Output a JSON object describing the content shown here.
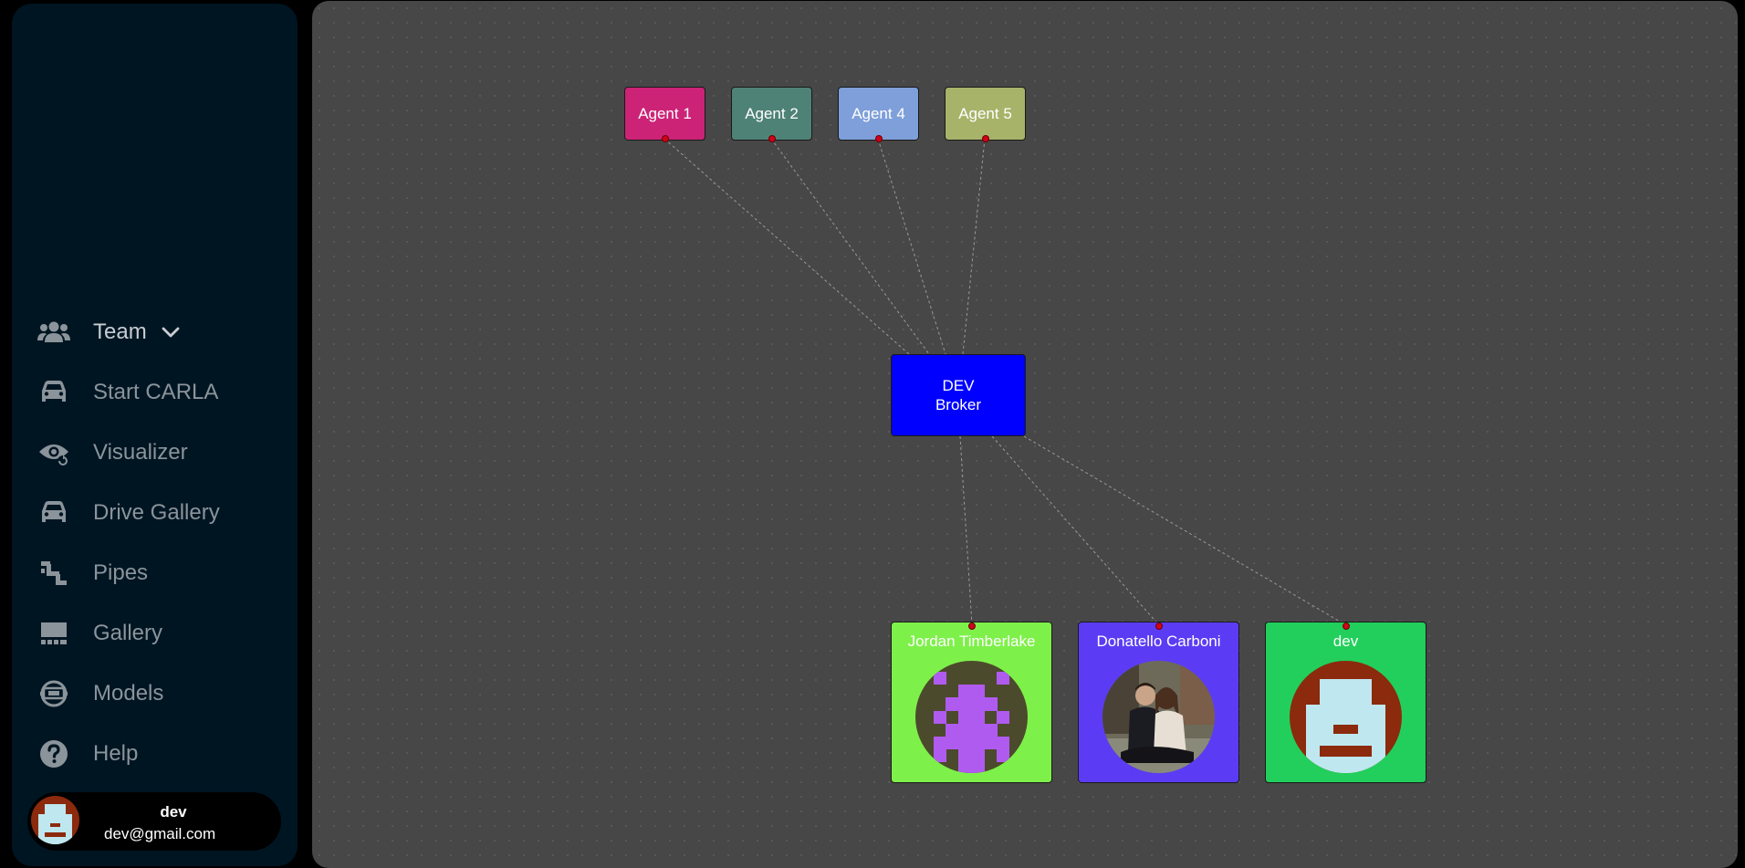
{
  "sidebar": {
    "items": [
      {
        "label": "Team",
        "icon": "team-icon",
        "name": "sidebar-item-team"
      },
      {
        "label": "Start CARLA",
        "icon": "car-icon",
        "name": "sidebar-item-start-carla"
      },
      {
        "label": "Visualizer",
        "icon": "eye-icon",
        "name": "sidebar-item-visualizer"
      },
      {
        "label": "Drive Gallery",
        "icon": "car-icon",
        "name": "sidebar-item-drive-gallery"
      },
      {
        "label": "Pipes",
        "icon": "pipes-icon",
        "name": "sidebar-item-pipes"
      },
      {
        "label": "Gallery",
        "icon": "gallery-icon",
        "name": "sidebar-item-gallery"
      },
      {
        "label": "Models",
        "icon": "models-icon",
        "name": "sidebar-item-models"
      },
      {
        "label": "Help",
        "icon": "help-icon",
        "name": "sidebar-item-help"
      }
    ],
    "user": {
      "name": "dev",
      "email": "dev@gmail.com"
    }
  },
  "graph": {
    "agents": [
      {
        "label": "Agent 1",
        "color": "#cc2377"
      },
      {
        "label": "Agent 2",
        "color": "#4f8277"
      },
      {
        "label": "Agent 4",
        "color": "#7e9fd9"
      },
      {
        "label": "Agent 5",
        "color": "#a8b36a"
      }
    ],
    "broker": {
      "line1": "DEV",
      "line2": "Broker",
      "color": "#0000fe"
    },
    "members": [
      {
        "name": "Jordan Timberlake",
        "color": "#7ef04a",
        "avatar": "purple-pixel-avatar"
      },
      {
        "name": "Donatello Carboni",
        "color": "#5b3cf4",
        "avatar": "couple-photo-avatar"
      },
      {
        "name": "dev",
        "color": "#22cf5c",
        "avatar": "red-pixel-avatar"
      }
    ],
    "handle_color": "#d0021b",
    "edge_color": "#9a9a9a"
  }
}
